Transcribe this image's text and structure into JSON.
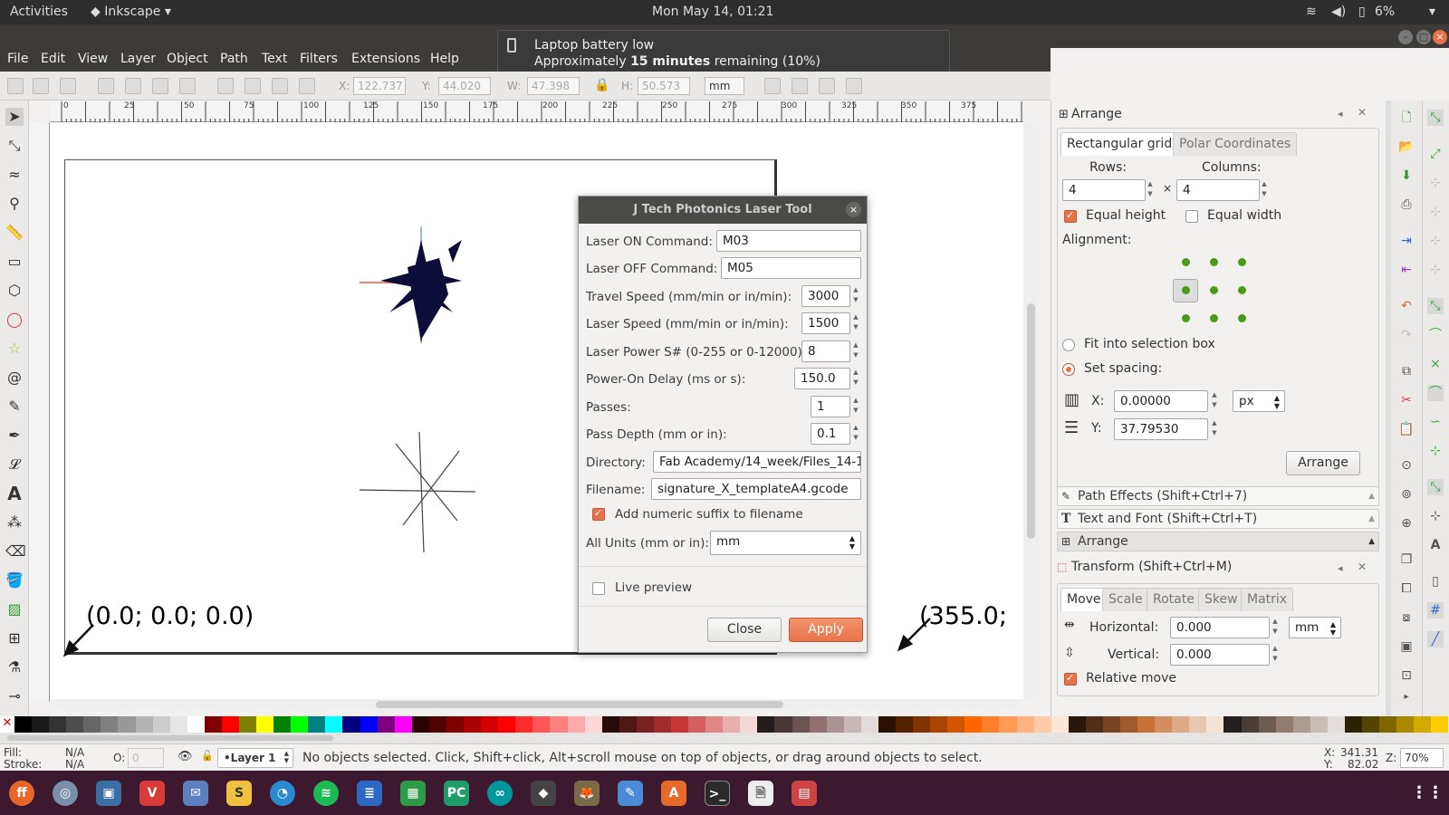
{
  "topbar": {
    "activities": "Activities",
    "app": "Inkscape",
    "clock": "Mon May 14, 01:21",
    "battery": "6%"
  },
  "notification": {
    "title": "Laptop battery low",
    "prefix": "Approximately",
    "bold": "15 minutes",
    "suffix": "remaining (10%)"
  },
  "menu": {
    "items": [
      "File",
      "Edit",
      "View",
      "Layer",
      "Object",
      "Path",
      "Text",
      "Filters",
      "Extensions",
      "Help"
    ]
  },
  "toolbar": {
    "x_label": "X:",
    "x": "122.737",
    "y_label": "Y:",
    "y": "44.020",
    "w_label": "W:",
    "w": "47.398",
    "h_label": "H:",
    "h": "50.573",
    "unit": "mm"
  },
  "ruler_top": [
    "0",
    "25",
    "50",
    "75",
    "100",
    "125",
    "150",
    "175",
    "200",
    "225",
    "250",
    "275",
    "300",
    "325",
    "350",
    "375"
  ],
  "canvas": {
    "origin_label": "(0.0; 0.0; 0.0)",
    "end_label": "(355.0;"
  },
  "laser_dialog": {
    "title": "J Tech Photonics Laser Tool",
    "fields": [
      {
        "label": "Laser ON Command:",
        "value": "M03"
      },
      {
        "label": "Laser OFF Command:",
        "value": "M05"
      },
      {
        "label": "Travel Speed (mm/min or in/min):",
        "value": "3000"
      },
      {
        "label": "Laser Speed (mm/min or in/min):",
        "value": "1500"
      },
      {
        "label": "Laser Power S# (0-255 or 0-12000):",
        "value": "8"
      },
      {
        "label": "Power-On Delay (ms or s):",
        "value": "150.0"
      },
      {
        "label": "Passes:",
        "value": "1"
      },
      {
        "label": "Pass Depth (mm or in):",
        "value": "0.1"
      },
      {
        "label": "Directory:",
        "value": "Fab Academy/14_week/Files_14-1"
      },
      {
        "label": "Filename:",
        "value": "signature_X_templateA4.gcode"
      }
    ],
    "suffix_checkbox": "Add numeric suffix to filename",
    "units_label": "All Units (mm or in):",
    "units_value": "mm",
    "live_preview": "Live preview",
    "close": "Close",
    "apply": "Apply"
  },
  "arrange": {
    "title": "Arrange",
    "tabs": [
      "Rectangular grid",
      "Polar Coordinates"
    ],
    "rows_label": "Rows:",
    "rows": "4",
    "columns_label": "Columns:",
    "columns": "4",
    "times": "×",
    "equal_height": "Equal height",
    "equal_width": "Equal width",
    "alignment": "Alignment:",
    "fit_box": "Fit into selection box",
    "set_spacing": "Set spacing:",
    "x_label": "X:",
    "x_value": "0.00000",
    "spacing_unit": "px",
    "y_label": "Y:",
    "y_value": "37.79530",
    "arrange_btn": "Arrange"
  },
  "collapsed_panels": [
    "Path Effects  (Shift+Ctrl+7)",
    "Text and Font (Shift+Ctrl+T)",
    "Arrange"
  ],
  "transform": {
    "title": "Transform (Shift+Ctrl+M)",
    "tabs": [
      "Move",
      "Scale",
      "Rotate",
      "Skew",
      "Matrix"
    ],
    "horizontal_label": "Horizontal:",
    "horizontal": "0.000",
    "unit": "mm",
    "vertical_label": "Vertical:",
    "vertical": "0.000",
    "relative": "Relative move"
  },
  "status": {
    "fill_label": "Fill:",
    "fill": "N/A",
    "stroke_label": "Stroke:",
    "stroke": "N/A",
    "opacity_label": "O:",
    "opacity": "0",
    "layer": "•Layer 1",
    "message": "No objects selected. Click, Shift+click, Alt+scroll mouse on top of objects, or drag around objects to select.",
    "cx_label": "X:",
    "cx": "341.31",
    "cy_label": "Y:",
    "cy": "82.02",
    "zoom_label": "Z:",
    "zoom": "70%"
  },
  "palette": [
    "#000000",
    "#1a1a1a",
    "#333333",
    "#4d4d4d",
    "#666666",
    "#808080",
    "#999999",
    "#b3b3b3",
    "#cccccc",
    "#e6e6e6",
    "#ffffff",
    "#800000",
    "#ff0000",
    "#808000",
    "#ffff00",
    "#008000",
    "#00ff00",
    "#008080",
    "#00ffff",
    "#000080",
    "#0000ff",
    "#800080",
    "#ff00ff",
    "#2b0000",
    "#550000",
    "#800000",
    "#aa0000",
    "#d40000",
    "#ff0000",
    "#ff2a2a",
    "#ff5555",
    "#ff8080",
    "#ffaaaa",
    "#ffd5d5",
    "#280b0b",
    "#501616",
    "#782121",
    "#a02c2c",
    "#c83737",
    "#d35f5f",
    "#de8787",
    "#e9afaf",
    "#f4d7d7",
    "#241c1c",
    "#483737",
    "#6c5353",
    "#916f6f",
    "#ac9393",
    "#c8b7b7",
    "#e3dbdb",
    "#2b1100",
    "#552200",
    "#803300",
    "#aa4400",
    "#d45500",
    "#ff6600",
    "#ff7f2a",
    "#ff9955",
    "#ffb380",
    "#ffccaa",
    "#ffe6d5",
    "#28170b",
    "#502d16",
    "#784421",
    "#a05a2c",
    "#c87137",
    "#d38d5f",
    "#deaa87",
    "#e9c6af",
    "#f4e3d7",
    "#241f1c",
    "#483e37",
    "#6c5d53",
    "#917c6f",
    "#ac9d93",
    "#c8beb7",
    "#e3dedb",
    "#2b2200",
    "#554400",
    "#806600",
    "#aa8800",
    "#d4aa00",
    "#ffcc00"
  ]
}
